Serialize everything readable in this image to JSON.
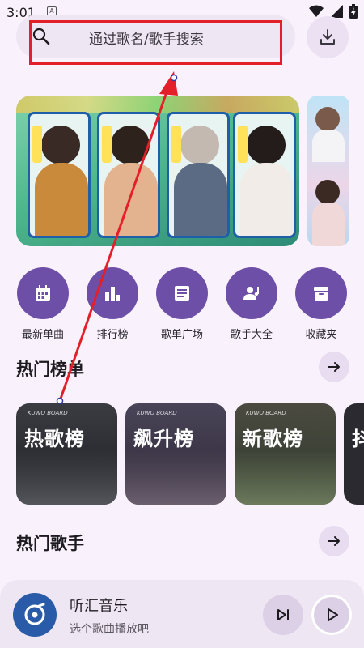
{
  "status_bar": {
    "time": "3:01",
    "notification_letter": "A"
  },
  "search": {
    "placeholder": "通过歌名/歌手搜索"
  },
  "icons": {
    "search": "search-icon",
    "download": "download-icon",
    "wifi": "wifi-icon",
    "signal": "signal-icon",
    "battery": "battery-icon"
  },
  "categories": [
    {
      "label": "最新单曲",
      "icon": "calendar-icon"
    },
    {
      "label": "排行榜",
      "icon": "bar-chart-icon"
    },
    {
      "label": "歌单广场",
      "icon": "playlist-icon"
    },
    {
      "label": "歌手大全",
      "icon": "singer-icon"
    },
    {
      "label": "收藏夹",
      "icon": "archive-icon"
    }
  ],
  "hot_charts": {
    "title": "热门榜单",
    "cards": [
      {
        "brand": "KUWO BOARD",
        "title": "热歌榜"
      },
      {
        "brand": "KUWO BOARD",
        "title": "飙升榜"
      },
      {
        "brand": "KUWO BOARD",
        "title": "新歌榜"
      },
      {
        "brand": "",
        "title": "抖"
      }
    ]
  },
  "hot_singers": {
    "title": "热门歌手"
  },
  "player": {
    "title": "听汇音乐",
    "subtitle": "选个歌曲播放吧"
  },
  "colors": {
    "accent": "#6e4fa8",
    "background": "#f9f2fc",
    "highlight_box": "#e3202a"
  }
}
